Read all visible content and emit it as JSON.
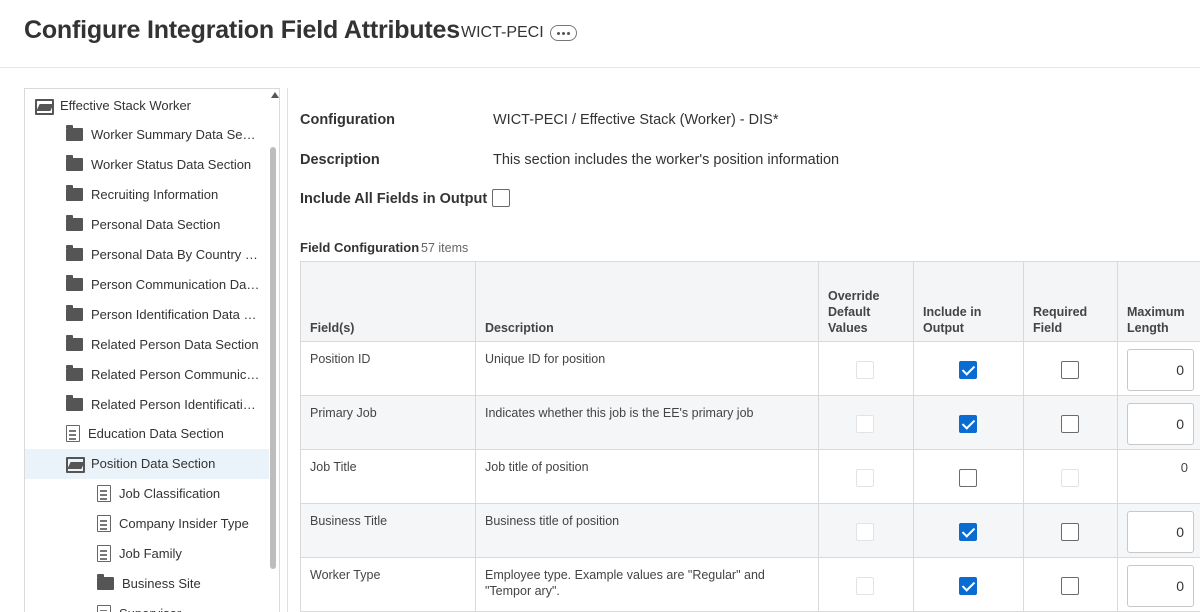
{
  "header": {
    "title": "Configure Integration Field Attributes",
    "subtitle": "WICT-PECI"
  },
  "tree": {
    "items": [
      {
        "label": "Effective Stack Worker",
        "icon": "folder-open-icon"
      },
      {
        "label": "Worker Summary Data Secti...",
        "icon": "folder-icon"
      },
      {
        "label": "Worker Status Data Section",
        "icon": "folder-icon"
      },
      {
        "label": "Recruiting Information",
        "icon": "folder-icon"
      },
      {
        "label": "Personal Data Section",
        "icon": "folder-icon"
      },
      {
        "label": "Personal Data By Country Se...",
        "icon": "folder-icon"
      },
      {
        "label": "Person Communication Data...",
        "icon": "folder-icon"
      },
      {
        "label": "Person Identification Data Se...",
        "icon": "folder-icon"
      },
      {
        "label": "Related Person Data Section",
        "icon": "folder-icon"
      },
      {
        "label": "Related Person Communicat...",
        "icon": "folder-icon"
      },
      {
        "label": "Related Person Identification...",
        "icon": "folder-icon"
      },
      {
        "label": "Education Data Section",
        "icon": "document-icon"
      },
      {
        "label": "Position Data Section",
        "icon": "folder-open-icon",
        "selected": true
      },
      {
        "label": "Job Classification",
        "icon": "document-icon"
      },
      {
        "label": "Company Insider Type",
        "icon": "document-icon"
      },
      {
        "label": "Job Family",
        "icon": "document-icon"
      },
      {
        "label": "Business Site",
        "icon": "folder-icon"
      },
      {
        "label": "Supervisor",
        "icon": "document-icon"
      }
    ]
  },
  "form": {
    "configuration_label": "Configuration",
    "configuration_value": "WICT-PECI / Effective Stack (Worker) - DIS*",
    "description_label": "Description",
    "description_value": "This section includes the worker's position information",
    "include_all_label": "Include All Fields in Output",
    "include_all_checked": false
  },
  "field_config": {
    "title": "Field Configuration",
    "count": "57 items",
    "columns": {
      "fields": "Field(s)",
      "description": "Description",
      "override": "Override Default Values",
      "include": "Include in Output",
      "required": "Required Field",
      "max_length": "Maximum Length"
    },
    "rows": [
      {
        "field": "Position ID",
        "description": "Unique ID for position",
        "include": true,
        "required": false,
        "required_disabled": false,
        "max_length": "0",
        "max_editable": true
      },
      {
        "field": "Primary Job",
        "description": "Indicates whether this job is the EE's primary job",
        "include": true,
        "required": false,
        "required_disabled": false,
        "max_length": "0",
        "max_editable": true
      },
      {
        "field": "Job Title",
        "description": "Job title of position",
        "include": false,
        "required": false,
        "required_disabled": true,
        "max_length": "0",
        "max_editable": false
      },
      {
        "field": "Business Title",
        "description": "Business title of position",
        "include": true,
        "required": false,
        "required_disabled": false,
        "max_length": "0",
        "max_editable": true
      },
      {
        "field": "Worker Type",
        "description": "Employee type.  Example values are \"Regular\" and \"Tempor ary\".",
        "include": true,
        "required": false,
        "required_disabled": false,
        "max_length": "0",
        "max_editable": true
      }
    ]
  }
}
